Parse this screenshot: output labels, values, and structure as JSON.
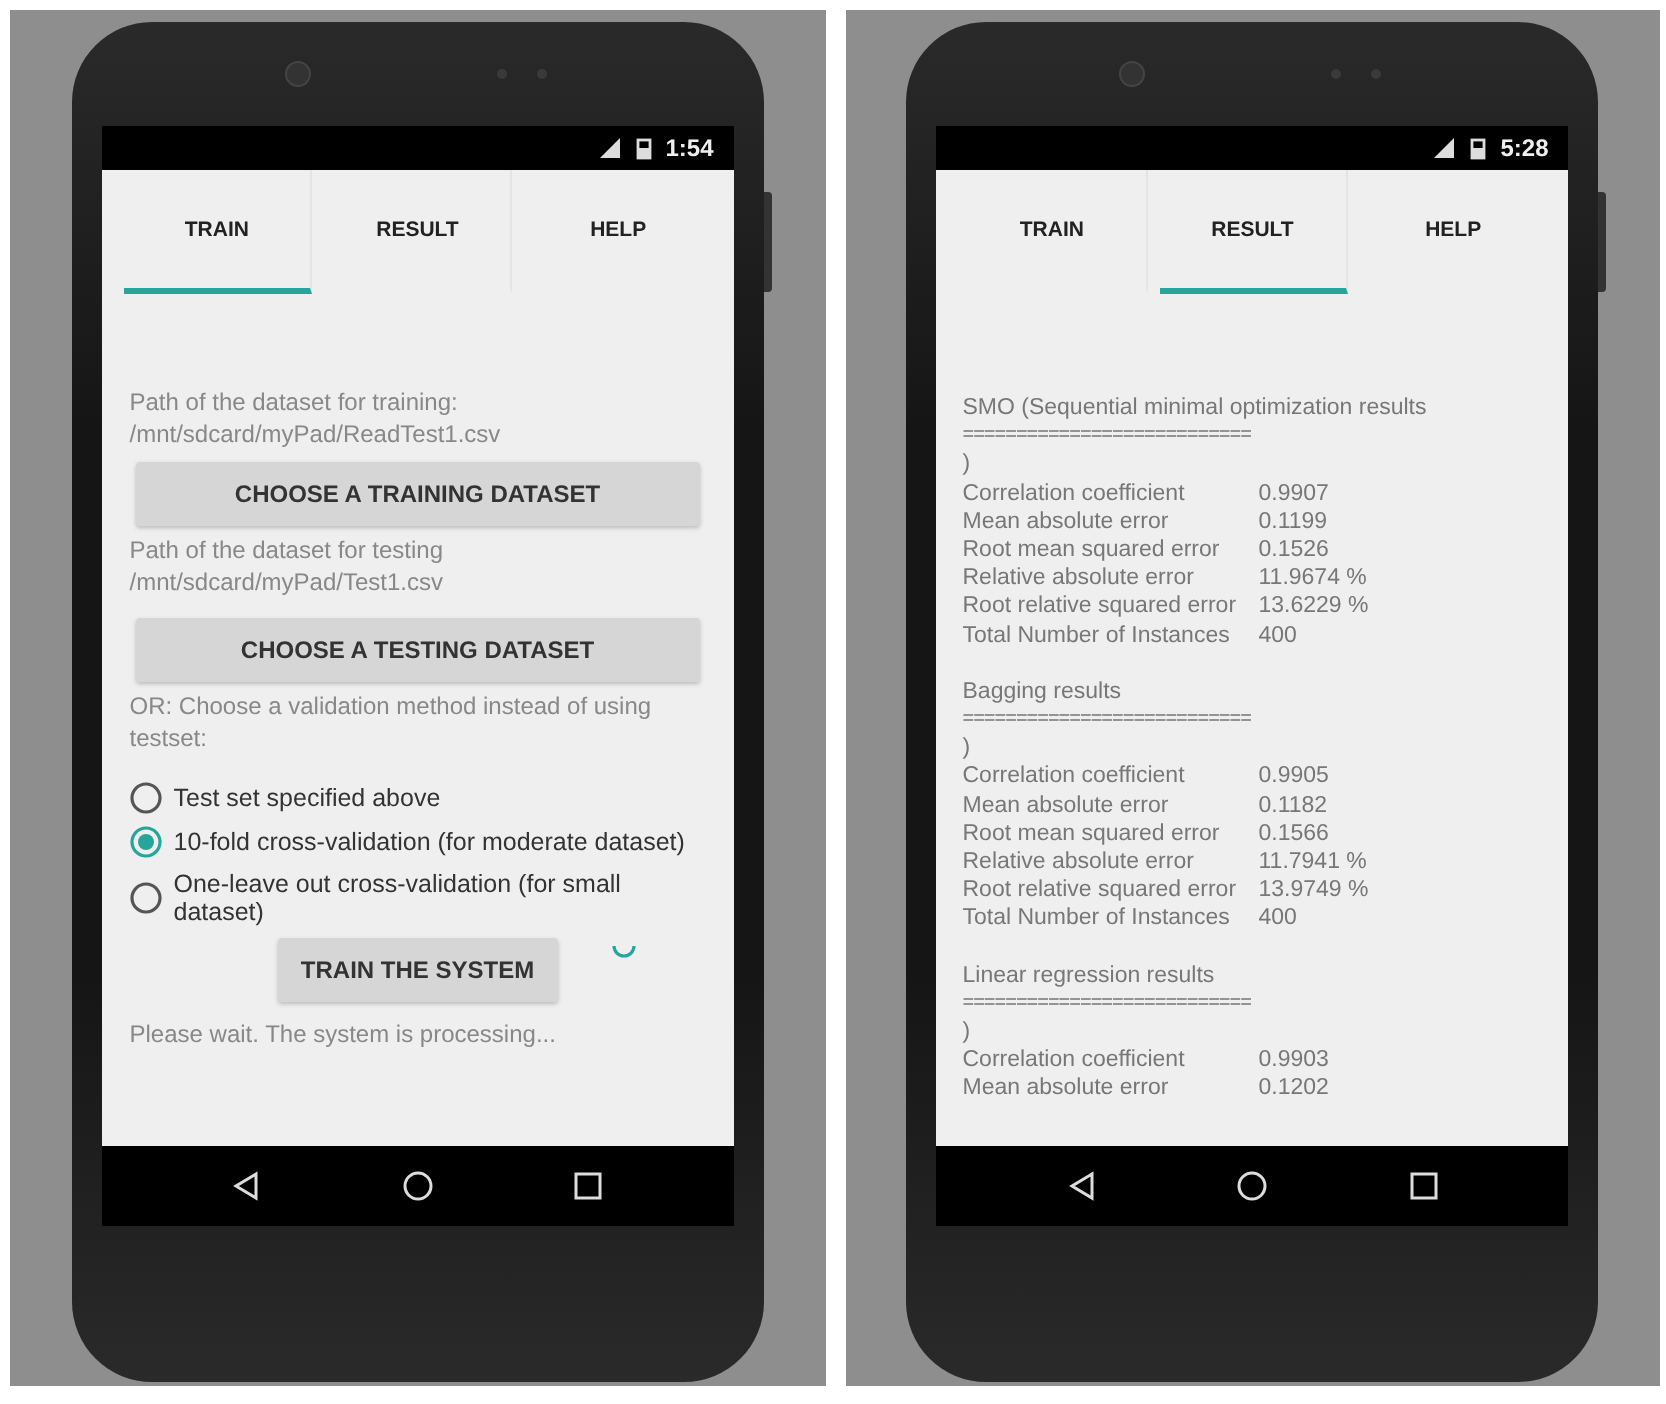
{
  "phones": [
    {
      "kind": "train",
      "status_bar": {
        "time": "1:54"
      },
      "tabs": [
        {
          "label": "TRAIN",
          "selected": true
        },
        {
          "label": "RESULT",
          "selected": false
        },
        {
          "label": "HELP",
          "selected": false
        }
      ],
      "train": {
        "training_path_label": "Path of the dataset for training:",
        "training_path": "/mnt/sdcard/myPad/ReadTest1.csv",
        "training_button": "CHOOSE A TRAINING DATASET",
        "testing_path_label": "Path of the dataset for testing",
        "testing_path": "/mnt/sdcard/myPad/Test1.csv",
        "testing_button": "CHOOSE A TESTING DATASET",
        "validation_prompt": "OR: Choose a validation method instead of using testset:",
        "options": [
          {
            "label": "Test set specified above",
            "selected": false
          },
          {
            "label": "10-fold cross-validation (for moderate dataset)",
            "selected": true
          },
          {
            "label": "One-leave out cross-validation (for small dataset)",
            "selected": false
          }
        ],
        "train_button": "TRAIN THE SYSTEM",
        "busy": true,
        "status_message": "Please wait. The system is processing..."
      }
    },
    {
      "kind": "result",
      "status_bar": {
        "time": "5:28"
      },
      "tabs": [
        {
          "label": "TRAIN",
          "selected": false
        },
        {
          "label": "RESULT",
          "selected": true
        },
        {
          "label": "HELP",
          "selected": false
        }
      ],
      "sections": [
        {
          "title": "SMO (Sequential minimal optimization results",
          "separator": "===========================",
          "paren": ")",
          "metrics": [
            {
              "name": "Correlation coefficient",
              "value": "0.9907"
            },
            {
              "name": "Mean absolute error",
              "value": "0.1199"
            },
            {
              "name": "Root mean squared error",
              "value": "0.1526"
            },
            {
              "name": "Relative absolute error",
              "value": "11.9674 %"
            },
            {
              "name": "Root relative squared error",
              "value": "13.6229 %"
            },
            {
              "name": "Total Number of Instances",
              "value": "400"
            }
          ]
        },
        {
          "title": "Bagging results",
          "separator": "===========================",
          "paren": ")",
          "metrics": [
            {
              "name": "Correlation coefficient",
              "value": "0.9905"
            },
            {
              "name": "Mean absolute error",
              "value": "0.1182"
            },
            {
              "name": "Root mean squared error",
              "value": "0.1566"
            },
            {
              "name": "Relative absolute error",
              "value": "11.7941 %"
            },
            {
              "name": "Root relative squared error",
              "value": "13.9749 %"
            },
            {
              "name": "Total Number of Instances",
              "value": "400"
            }
          ]
        },
        {
          "title": "Linear regression results",
          "separator": "===========================",
          "paren": ")",
          "metrics": [
            {
              "name": "Correlation coefficient",
              "value": "0.9903"
            },
            {
              "name": "Mean absolute error",
              "value": "0.1202"
            }
          ]
        }
      ]
    }
  ]
}
